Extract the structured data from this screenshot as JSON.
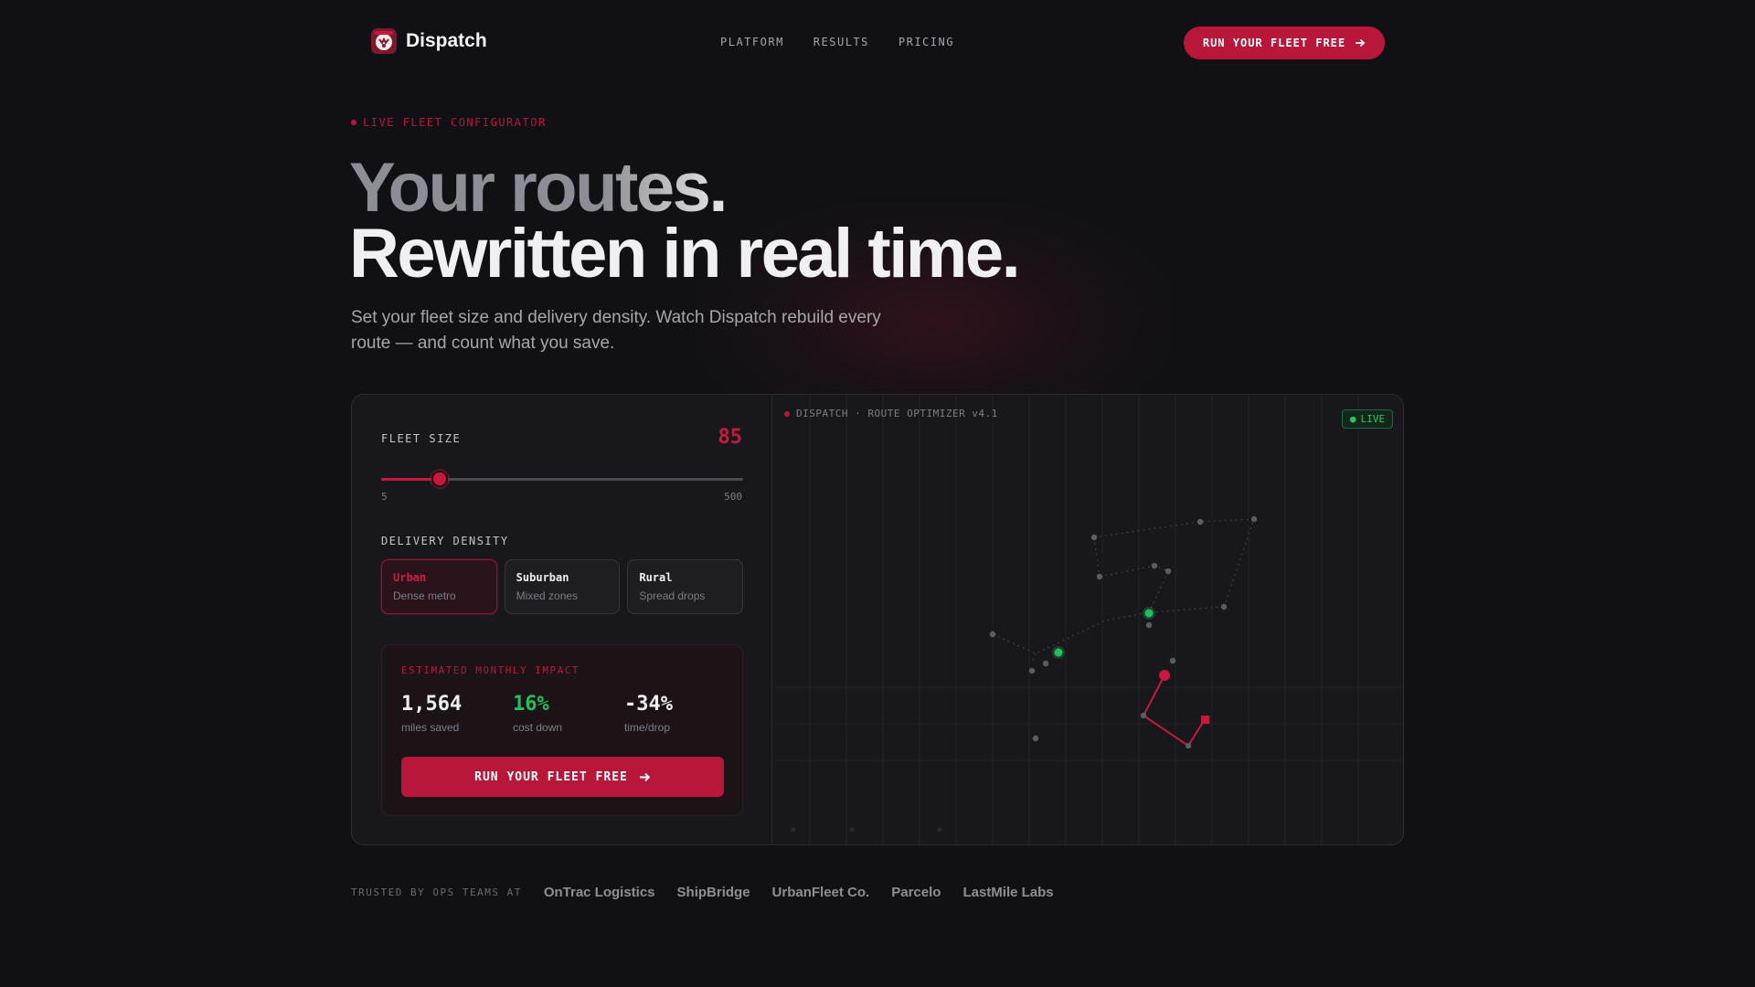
{
  "brand": {
    "name": "Dispatch"
  },
  "nav": {
    "links": [
      "PLATFORM",
      "RESULTS",
      "PRICING"
    ],
    "cta": "RUN YOUR FLEET FREE"
  },
  "hero": {
    "eyebrow": "LIVE FLEET CONFIGURATOR",
    "headline_line1": "Your routes.",
    "headline_line2": "Rewritten in real time.",
    "subcopy": "Set your fleet size and delivery density. Watch Dispatch rebuild every route — and count what you save."
  },
  "config": {
    "fleet_label": "FLEET SIZE",
    "fleet_value": "85",
    "slider": {
      "min": 5,
      "max": 500,
      "value": 85,
      "min_label": "5",
      "max_label": "500"
    },
    "density_label": "DELIVERY DENSITY",
    "density_options": [
      {
        "name": "Urban",
        "desc": "Dense metro",
        "selected": true
      },
      {
        "name": "Suburban",
        "desc": "Mixed zones",
        "selected": false
      },
      {
        "name": "Rural",
        "desc": "Spread drops",
        "selected": false
      }
    ],
    "impact": {
      "title": "ESTIMATED MONTHLY IMPACT",
      "stats": [
        {
          "value": "1,564",
          "label": "miles saved"
        },
        {
          "value": "16%",
          "label": "cost down"
        },
        {
          "value": "-34%",
          "label": "time/drop"
        }
      ],
      "cta": "RUN YOUR FLEET FREE"
    }
  },
  "optimizer": {
    "label": "DISPATCH · ROUTE OPTIMIZER v4.1",
    "live_badge": "LIVE"
  },
  "trusted": {
    "label": "TRUSTED BY OPS TEAMS AT",
    "logos": [
      "OnTrac Logistics",
      "ShipBridge",
      "UrbanFleet Co.",
      "Parcelo",
      "LastMile Labs"
    ]
  },
  "colors": {
    "accent": "#b8173a",
    "accent_bright": "#c8183f",
    "success": "#22c05a",
    "background": "#111115",
    "card": "#17171b"
  },
  "icons": {
    "brand": "shield-logo-icon",
    "cta_arrow": "arrow-right-icon",
    "status_dot": "dot-icon"
  }
}
